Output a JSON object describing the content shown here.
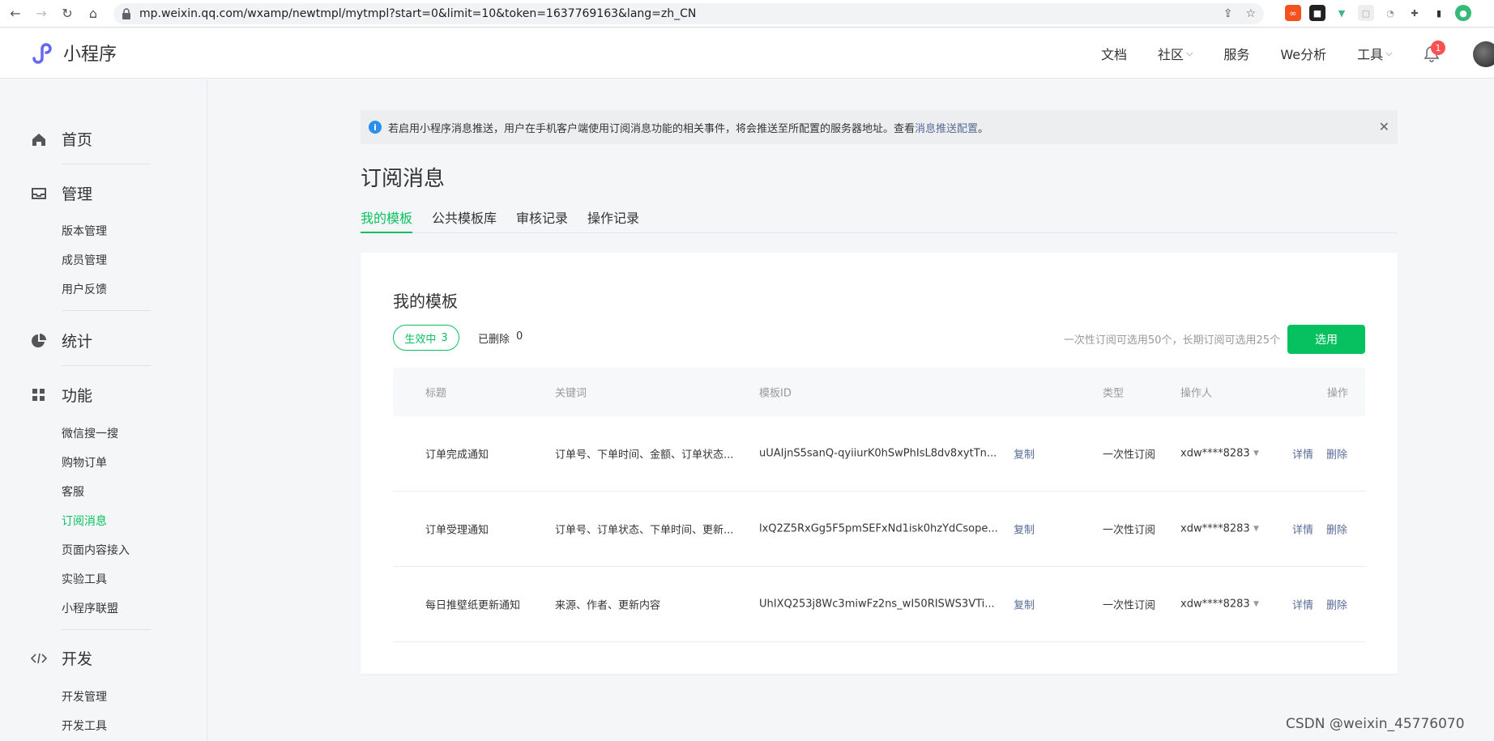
{
  "browser": {
    "url": "mp.weixin.qq.com/wxamp/newtmpl/mytmpl?start=0&limit=10&token=1637769163&lang=zh_CN"
  },
  "header": {
    "logo_text": "小程序",
    "menu": [
      {
        "label": "文档",
        "dropdown": false
      },
      {
        "label": "社区",
        "dropdown": true
      },
      {
        "label": "服务",
        "dropdown": false
      },
      {
        "label": "We分析",
        "dropdown": false
      },
      {
        "label": "工具",
        "dropdown": true
      }
    ],
    "notification_count": "1"
  },
  "sidebar": {
    "sections": [
      {
        "label": "首页",
        "icon": "home-icon",
        "items": []
      },
      {
        "label": "管理",
        "icon": "inbox-icon",
        "items": [
          "版本管理",
          "成员管理",
          "用户反馈"
        ]
      },
      {
        "label": "统计",
        "icon": "pie-chart-icon",
        "items": []
      },
      {
        "label": "功能",
        "icon": "grid-icon",
        "items": [
          "微信搜一搜",
          "购物订单",
          "客服",
          "订阅消息",
          "页面内容接入",
          "实验工具",
          "小程序联盟"
        ]
      },
      {
        "label": "开发",
        "icon": "code-icon",
        "items": [
          "开发管理",
          "开发工具"
        ]
      }
    ],
    "active_item": "订阅消息"
  },
  "notice": {
    "text": "若启用小程序消息推送，用户在手机客户端使用订阅消息功能的相关事件，将会推送至所配置的服务器地址。查看 ",
    "link": "消息推送配置",
    "suffix": "。"
  },
  "page_title": "订阅消息",
  "tabs": [
    "我的模板",
    "公共模板库",
    "审核记录",
    "操作记录"
  ],
  "card": {
    "title": "我的模板",
    "active_label": "生效中",
    "active_count": "3",
    "deleted_label": "已删除",
    "deleted_count": "0",
    "quota_text": "一次性订阅可选用50个，长期订阅可选用25个",
    "select_button": "选用",
    "columns": [
      "标题",
      "关键词",
      "模板ID",
      "类型",
      "操作人",
      "操作"
    ],
    "rows": [
      {
        "title": "订单完成通知",
        "keywords": "订单号、下单时间、金额、订单状态...",
        "template_id": "uUAIjnS5sanQ-qyiiurK0hSwPhIsL8dv8xytTn...",
        "copy": "复制",
        "type": "一次性订阅",
        "operator": "xdw****8283",
        "detail": "详情",
        "delete": "删除"
      },
      {
        "title": "订单受理通知",
        "keywords": "订单号、订单状态、下单时间、更新...",
        "template_id": "lxQ2Z5RxGg5F5pmSEFxNd1isk0hzYdCsope...",
        "copy": "复制",
        "type": "一次性订阅",
        "operator": "xdw****8283",
        "detail": "详情",
        "delete": "删除"
      },
      {
        "title": "每日推壁纸更新通知",
        "keywords": "来源、作者、更新内容",
        "template_id": "UhIXQ253j8Wc3miwFz2ns_wI50RISWS3VTi...",
        "copy": "复制",
        "type": "一次性订阅",
        "operator": "xdw****8283",
        "detail": "详情",
        "delete": "删除"
      }
    ]
  },
  "watermark": "CSDN @weixin_45776070",
  "colors": {
    "accent": "#07c160",
    "link": "#576b95",
    "badge": "#fa5151",
    "info": "#2b8ff0"
  }
}
